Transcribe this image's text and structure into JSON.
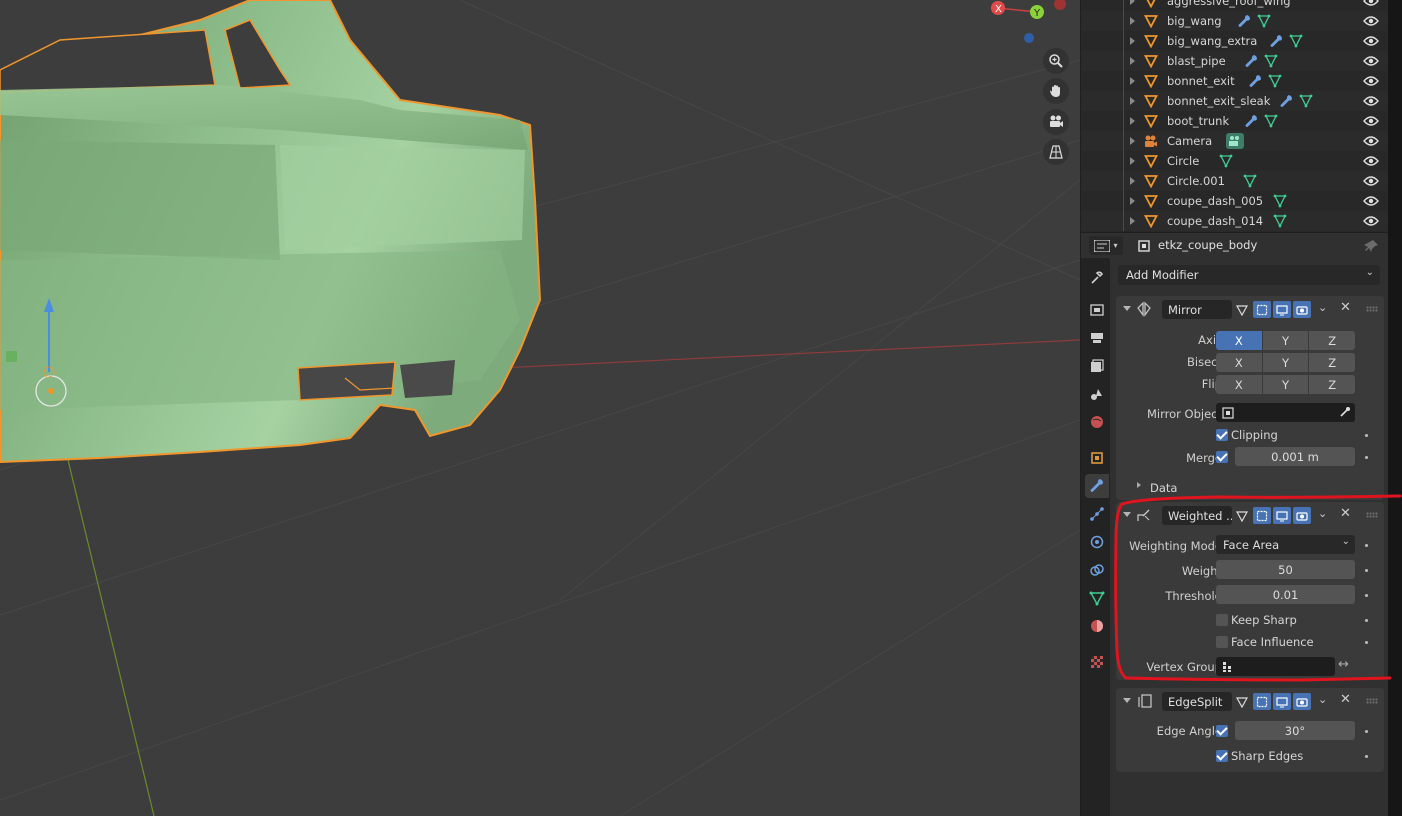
{
  "outliner": {
    "items": [
      {
        "name": "aggressive_roof_wing",
        "type": "mesh"
      },
      {
        "name": "big_wang",
        "type": "mesh"
      },
      {
        "name": "big_wang_extra",
        "type": "mesh"
      },
      {
        "name": "blast_pipe",
        "type": "mesh"
      },
      {
        "name": "bonnet_exit",
        "type": "mesh"
      },
      {
        "name": "bonnet_exit_sleak",
        "type": "mesh"
      },
      {
        "name": "boot_trunk",
        "type": "mesh"
      },
      {
        "name": "Camera",
        "type": "camera"
      },
      {
        "name": "Circle",
        "type": "mesh"
      },
      {
        "name": "Circle.001",
        "type": "mesh"
      },
      {
        "name": "coupe_dash_005",
        "type": "mesh"
      },
      {
        "name": "coupe_dash_014",
        "type": "mesh"
      }
    ]
  },
  "properties": {
    "object_name": "etkz_coupe_body",
    "add_modifier_label": "Add Modifier"
  },
  "mirror": {
    "name": "Mirror",
    "axis_label": "Axis",
    "bisect_label": "Bisect",
    "flip_label": "Flip",
    "x": "X",
    "y": "Y",
    "z": "Z",
    "mirror_object_label": "Mirror Object",
    "clipping_label": "Clipping",
    "merge_label": "Merge",
    "merge_value": "0.001 m",
    "data_label": "Data"
  },
  "weighted": {
    "name": "Weighted ...",
    "weighting_mode_label": "Weighting Mode",
    "weighting_mode_value": "Face Area",
    "weight_label": "Weight",
    "weight_value": "50",
    "threshold_label": "Threshold",
    "threshold_value": "0.01",
    "keep_sharp_label": "Keep Sharp",
    "face_influence_label": "Face Influence",
    "vertex_group_label": "Vertex Group"
  },
  "edgesplit": {
    "name": "EdgeSplit",
    "edge_angle_label": "Edge Angle",
    "edge_angle_value": "30°",
    "sharp_edges_label": "Sharp Edges"
  },
  "gizmo": {
    "x": "X",
    "y": "Y"
  },
  "colors": {
    "accent_blue": "#4772b3",
    "selection_orange": "#f0962d",
    "mesh_green": "#8fbf8c",
    "annotation_red": "#e0141e"
  }
}
